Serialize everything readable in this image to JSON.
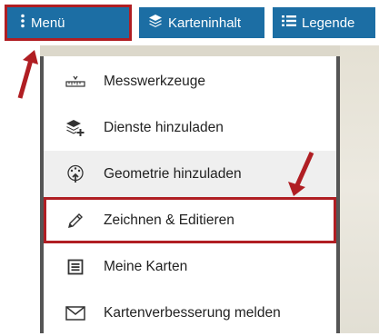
{
  "toolbar": {
    "menu_label": "Menü",
    "karteninhalt_label": "Karteninhalt",
    "legende_label": "Legende"
  },
  "menu": {
    "items": [
      {
        "label": "Messwerkzeuge",
        "icon": "ruler-icon"
      },
      {
        "label": "Dienste hinzuladen",
        "icon": "layers-add-icon"
      },
      {
        "label": "Geometrie hinzuladen",
        "icon": "geometry-upload-icon"
      },
      {
        "label": "Zeichnen & Editieren",
        "icon": "pencil-icon"
      },
      {
        "label": "Meine Karten",
        "icon": "list-document-icon"
      },
      {
        "label": "Kartenverbesserung melden",
        "icon": "envelope-icon"
      }
    ]
  },
  "colors": {
    "button_bg": "#1c6ea4",
    "highlight_red": "#b01e23",
    "hover_bg": "#efefef"
  }
}
